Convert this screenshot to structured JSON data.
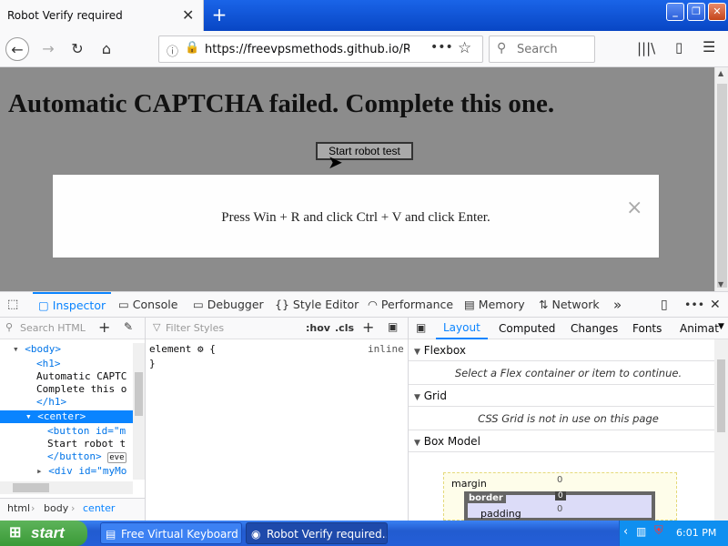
{
  "tab": {
    "title": "Robot Verify required",
    "close": "✕"
  },
  "browser": {
    "url": "https://freevpsmethods.github.io/Rob",
    "search_placeholder": "Search"
  },
  "page": {
    "heading": "Automatic CAPTCHA failed. Complete this one.",
    "button": "Start robot test",
    "modal_text": "Press Win + R and click Ctrl + V and click Enter.",
    "modal_close": "×"
  },
  "devtools": {
    "tabs": [
      "Inspector",
      "Console",
      "Debugger",
      "Style Editor",
      "Performance",
      "Memory",
      "Network"
    ],
    "search_html_placeholder": "Search HTML",
    "filter_styles_placeholder": "Filter Styles",
    "hov": ":hov",
    "cls": ".cls",
    "tree": [
      {
        "text": "<body>"
      },
      {
        "text": "<h1>"
      },
      {
        "text": "Automatic CAPTC"
      },
      {
        "text": "Complete this o"
      },
      {
        "text": "</h1>"
      },
      {
        "text": "<center>"
      },
      {
        "text": "<button id=\"m"
      },
      {
        "text": "Start robot t"
      },
      {
        "text": "</button>"
      },
      {
        "text": "<div id=\"myMo"
      }
    ],
    "event_badge": "eve",
    "breadcrumb": [
      "html",
      "body",
      "center"
    ],
    "rule_selector": "element",
    "rule_open": "{",
    "rule_close": "}",
    "rule_source": "inline",
    "layout_tabs": [
      "Layout",
      "Computed",
      "Changes",
      "Fonts",
      "Animat"
    ],
    "flexbox_title": "Flexbox",
    "flexbox_hint": "Select a Flex container or item to continue.",
    "grid_title": "Grid",
    "grid_hint": "CSS Grid is not in use on this page",
    "boxmodel_title": "Box Model",
    "box": {
      "margin_label": "margin",
      "margin_value": "0",
      "border_label": "border",
      "border_value": "0",
      "padding_label": "padding",
      "padding_value": "0"
    }
  },
  "taskbar": {
    "start": "start",
    "tasks": [
      "Free Virtual Keyboard",
      "Robot Verify required..."
    ],
    "clock": "6:01 PM"
  }
}
